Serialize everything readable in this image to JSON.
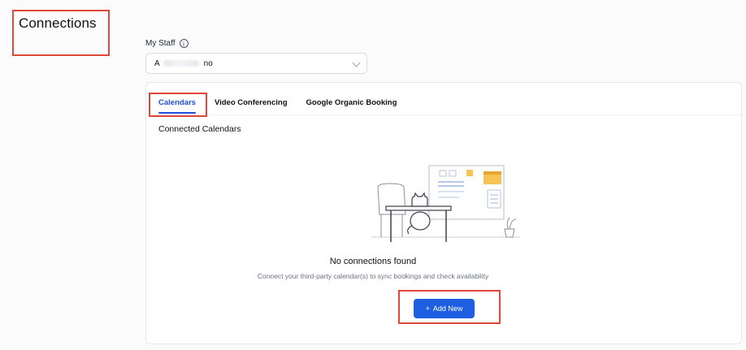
{
  "page": {
    "title": "Connections"
  },
  "staff": {
    "label": "My Staff",
    "value_prefix": "A",
    "value_suffix": "no"
  },
  "tabs": [
    {
      "label": "Calendars",
      "active": true
    },
    {
      "label": "Video Conferencing",
      "active": false
    },
    {
      "label": "Google Organic Booking",
      "active": false
    }
  ],
  "section": {
    "title": "Connected Calendars"
  },
  "empty_state": {
    "title": "No connections found",
    "subtitle": "Connect your third-party calendar(s) to sync bookings and check availability"
  },
  "actions": {
    "add_new_label": "Add New",
    "add_new_icon": "+"
  },
  "colors": {
    "accent": "#1d5fe0",
    "highlight": "#e1473a"
  }
}
